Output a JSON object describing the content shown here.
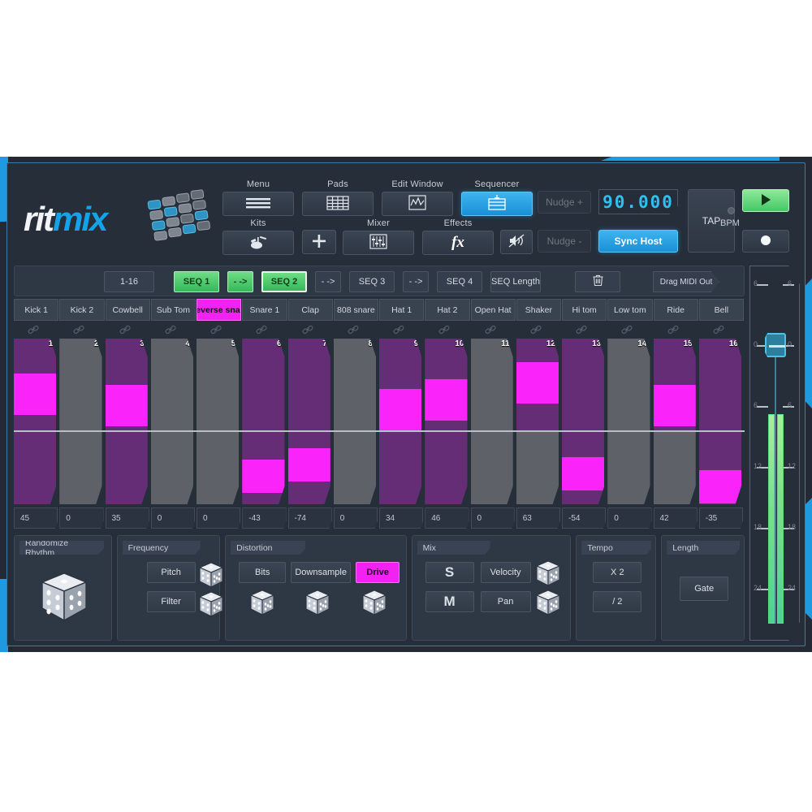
{
  "app": {
    "logo_rit": "rit",
    "logo_mix": "mix"
  },
  "toolbar": {
    "row1": [
      {
        "label": "Menu",
        "icon": "hamburger-icon",
        "state": "normal"
      },
      {
        "label": "Pads",
        "icon": "pad-grid-icon",
        "state": "normal"
      },
      {
        "label": "Edit Window",
        "icon": "waveform-icon",
        "state": "normal"
      },
      {
        "label": "Sequencer",
        "icon": "sequencer-icon",
        "state": "active"
      }
    ],
    "row2": [
      {
        "label": "Kits",
        "icon": "drumkit-icon",
        "state": "normal"
      },
      {
        "label": "",
        "icon": "plus-icon",
        "state": "normal"
      },
      {
        "label": "Mixer",
        "icon": "mixer-icon",
        "state": "normal"
      },
      {
        "label": "Effects",
        "icon": "fx-icon",
        "state": "normal"
      },
      {
        "label": "",
        "icon": "mute-icon",
        "state": "normal"
      }
    ],
    "nudge_plus": "Nudge +",
    "nudge_minus": "Nudge -",
    "bpm_value": "90.000",
    "bpm_caption": "BPM",
    "sync_host": "Sync Host",
    "tap": "TAP",
    "play_icon": "play-icon",
    "record_icon": "record-icon"
  },
  "seqbar": {
    "range": "1-16",
    "seq1": "SEQ 1",
    "seq2": "SEQ 2",
    "seq3": "SEQ 3",
    "seq4": "SEQ 4",
    "arrow": "- ->",
    "seq_length": "SEQ Length",
    "trash_icon": "trash-icon",
    "drag_midi": "Drag MIDI Out"
  },
  "tracks": {
    "active_index": 4,
    "items": [
      "Kick 1",
      "Kick 2",
      "Cowbell",
      "Sub Tom",
      "Reverse snare",
      "Snare 1",
      "Clap",
      "808 snare",
      "Hat 1",
      "Hat 2",
      "Open Hat",
      "Shaker",
      "Hi tom",
      "Low tom",
      "Ride",
      "Bell"
    ]
  },
  "sequencer": {
    "step_numbers": [
      "1",
      "2",
      "3",
      "4",
      "5",
      "6",
      "7",
      "8",
      "9",
      "10",
      "11",
      "12",
      "13",
      "14",
      "15",
      "16"
    ],
    "link_icon": "link-icon",
    "rowA_on": [
      true,
      false,
      true,
      false,
      false,
      true,
      true,
      false,
      true,
      true,
      false,
      true,
      true,
      false,
      true,
      true
    ],
    "rowA_vel": [
      0.62,
      0.0,
      0.5,
      0.0,
      0.0,
      0.0,
      0.0,
      0.0,
      0.42,
      0.56,
      0.0,
      0.74,
      0.0,
      0.0,
      0.5,
      0.0
    ],
    "rowB_on": [
      true,
      false,
      true,
      false,
      false,
      true,
      true,
      false,
      true,
      true,
      false,
      false,
      true,
      false,
      false,
      true
    ],
    "rowB_vel": [
      0.0,
      0.0,
      0.0,
      0.0,
      0.0,
      0.6,
      0.76,
      0.0,
      0.0,
      0.0,
      0.0,
      0.0,
      0.64,
      0.0,
      0.0,
      0.46
    ],
    "values": [
      "45",
      "0",
      "35",
      "0",
      "0",
      "-43",
      "-74",
      "0",
      "34",
      "46",
      "0",
      "63",
      "-54",
      "0",
      "42",
      "-35"
    ]
  },
  "panels": {
    "randomize": {
      "title": "Randomize Rhythm",
      "dice_icon": "dice-icon"
    },
    "frequency": {
      "title": "Frequency",
      "pitch": "Pitch",
      "filter": "Filter",
      "dice_pitch": "dice-icon",
      "dice_filter": "dice-icon"
    },
    "distortion": {
      "title": "Distortion",
      "bits": "Bits",
      "downsample": "Downsample",
      "drive": "Drive",
      "active": "Drive",
      "dice_bits": "dice-icon",
      "dice_downsample": "dice-icon",
      "dice_drive": "dice-icon"
    },
    "mix": {
      "title": "Mix",
      "solo": "S",
      "mute": "M",
      "velocity": "Velocity",
      "pan": "Pan",
      "dice_velocity": "dice-icon",
      "dice_pan": "dice-icon"
    },
    "tempo": {
      "title": "Tempo",
      "double": "X 2",
      "half": "/ 2"
    },
    "length": {
      "title": "Length",
      "gate": "Gate"
    }
  },
  "strip": {
    "scale": [
      "6",
      "0",
      "6",
      "12",
      "18",
      "24"
    ],
    "fader_label": "volume-fader",
    "meter_level": 0.53
  },
  "colors": {
    "accent_blue": "#1e9ae0",
    "active_magenta": "#f223f2",
    "step_on_purple": "#662d77",
    "step_off_gray": "#5e6268",
    "seq_green": "#46c866",
    "panel_bg": "#2e3744"
  }
}
